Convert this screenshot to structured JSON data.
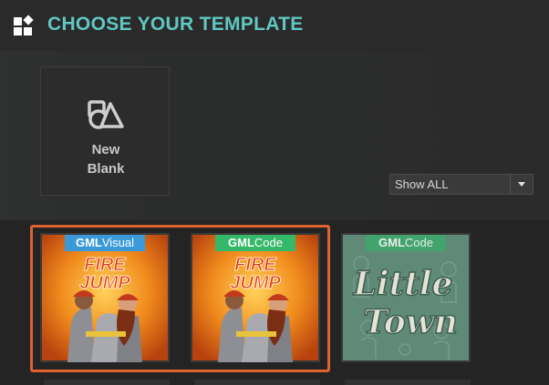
{
  "header": {
    "title": "CHOOSE YOUR TEMPLATE"
  },
  "new_blank": {
    "line1": "New",
    "line2": "Blank"
  },
  "filter": {
    "selected": "Show ALL"
  },
  "templates": [
    {
      "tag_bold": "GML",
      "tag_rest": "Visual",
      "art_line1": "FIRE",
      "art_line2": "JUMP",
      "selected": true
    },
    {
      "tag_bold": "GML",
      "tag_rest": "Code",
      "art_line1": "FIRE",
      "art_line2": "JUMP",
      "selected": true
    },
    {
      "tag_bold": "GML",
      "tag_rest": "Code",
      "art_line1": "Little",
      "art_line2": "Town",
      "selected": false
    }
  ],
  "colors": {
    "accent": "#5fc8c2",
    "selection": "#e0622f",
    "tag_visual": "#3a9ad9",
    "tag_code": "#36b86a"
  }
}
